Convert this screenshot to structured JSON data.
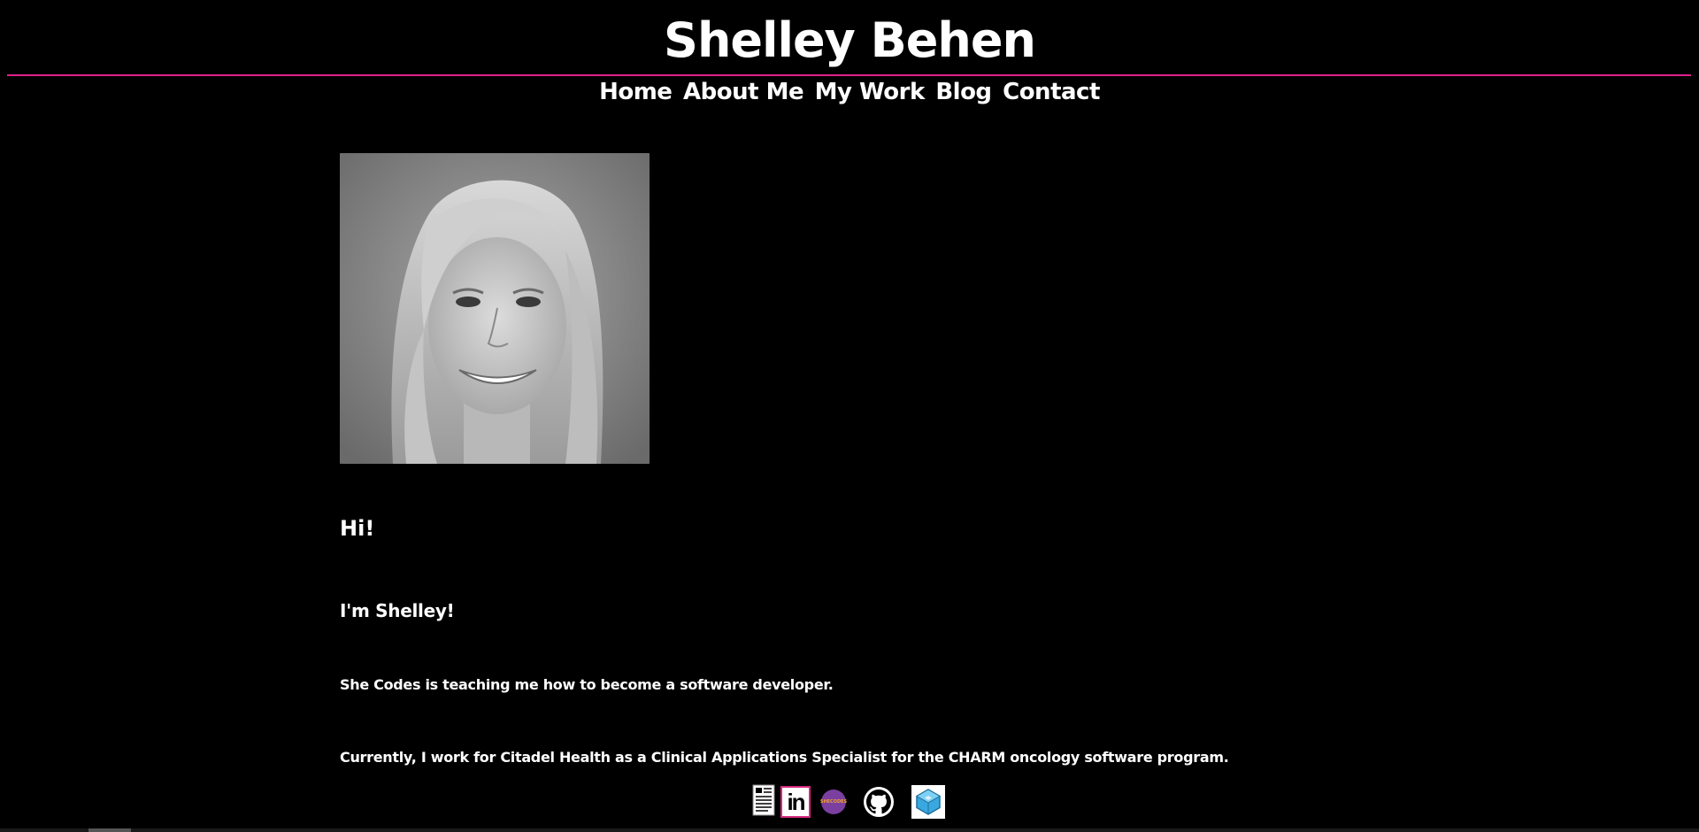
{
  "site": {
    "title": "Shelley Behen"
  },
  "nav": {
    "items": [
      {
        "label": "Home"
      },
      {
        "label": "About Me"
      },
      {
        "label": "My Work"
      },
      {
        "label": "Blog"
      },
      {
        "label": "Contact"
      }
    ]
  },
  "colors": {
    "background": "#000000",
    "text": "#ffffff",
    "accent": "#e0218a"
  },
  "profile": {
    "photo_icon": "portrait-photo",
    "greeting": "Hi!",
    "intro": "I'm Shelley!",
    "paragraph1": "She Codes is teaching me how to become a software developer.",
    "paragraph2": "Currently, I work for Citadel Health as a Clinical Applications Specialist for the CHARM oncology software program."
  },
  "socials": {
    "items": [
      {
        "icon": "resume-icon"
      },
      {
        "icon": "linkedin-icon",
        "text": "in"
      },
      {
        "icon": "shecodes-icon",
        "text": "SHECODES"
      },
      {
        "icon": "github-icon"
      },
      {
        "icon": "codepen-icon"
      }
    ]
  }
}
